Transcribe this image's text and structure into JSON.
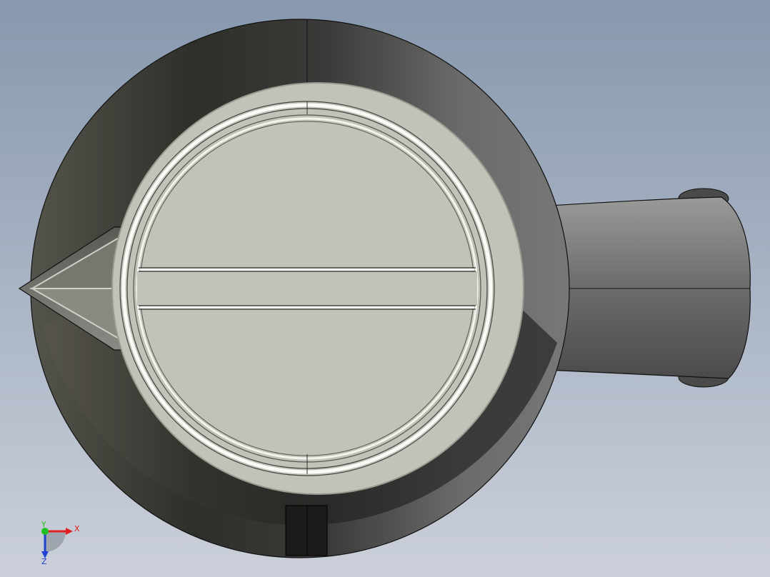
{
  "scene": {
    "background_top": "#8a9ab0",
    "background_bottom": "#c9ced8",
    "outer_body_color": "#2e2f2b",
    "face_color": "#c2c2b8",
    "handle_color": "#6a6a68"
  },
  "triad": {
    "x_label": "X",
    "y_label": "Y",
    "z_label": "Z",
    "x_color": "#e02020",
    "y_color": "#20c020",
    "z_color": "#2040d0"
  }
}
